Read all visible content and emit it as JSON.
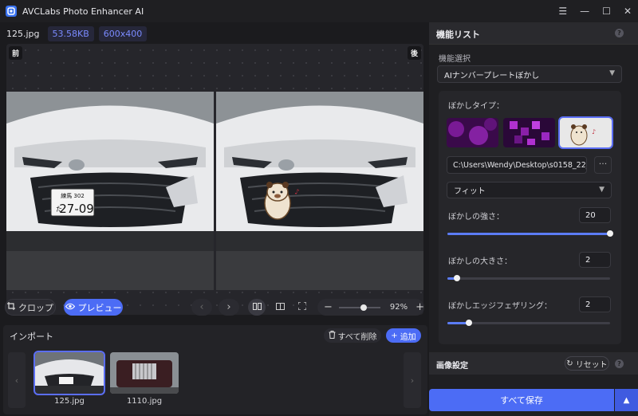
{
  "app": {
    "title": "AVCLabs Photo Enhancer AI"
  },
  "window_controls": {
    "menu": "☰",
    "minimize": "—",
    "maximize": "☐",
    "close": "✕"
  },
  "file_info": {
    "name": "125.jpg",
    "size": "53.58KB",
    "dimensions": "600x400"
  },
  "canvas": {
    "before_tag": "前",
    "after_tag": "後",
    "plate_top": "練馬 302",
    "plate_kana": "た",
    "plate_number": "27-09"
  },
  "toolbar": {
    "crop_label": "クロップ",
    "preview_label": "プレビュー",
    "zoom_value": "92%",
    "zoom_level": 0.6
  },
  "import": {
    "title": "インポート",
    "delete_all_label": "すべて削除",
    "add_label": "追加",
    "thumbnails": [
      {
        "label": "125.jpg"
      },
      {
        "label": "1110.jpg"
      }
    ]
  },
  "panel": {
    "title": "機能リスト",
    "select_label": "機能選択",
    "selected_feature": "AIナンバープレートぼかし",
    "blur_type_label": "ぼかしタイプ：",
    "path_value": "C:\\Users\\Wendy\\Desktop\\s0158_22_",
    "path_button": "···",
    "fit_value": "フィット",
    "strength": {
      "label": "ぼかしの強さ：",
      "value": "20",
      "level": 1.0
    },
    "size": {
      "label": "ぼかしの大きさ：",
      "value": "2",
      "level": 0.06
    },
    "feather": {
      "label": "ぼかしエッジフェザリング：",
      "value": "2",
      "level": 0.13
    },
    "image_settings_title": "画像設定",
    "reset_label": "リセット",
    "save_label": "すべて保存"
  },
  "colors": {
    "accent": "#4c6cf5",
    "background": "#1b1b1e",
    "panel": "#1f1f22"
  }
}
